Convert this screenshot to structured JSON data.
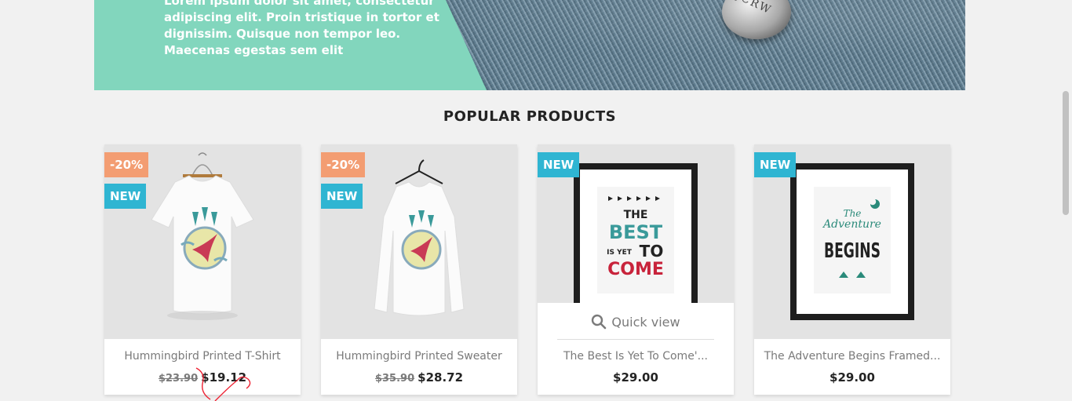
{
  "banner": {
    "text": "Lorem ipsum dolor sit amet, consectetur adipiscing elit. Proin tristique in tortor et dignissim. Quisque non tempor leo. Maecenas egestas sem elit",
    "stud_text": "JCRW",
    "colors": {
      "panel": "#82d6bd"
    }
  },
  "section": {
    "title": "POPULAR PRODUCTS"
  },
  "products": [
    {
      "name": "Hummingbird Printed T-Shirt",
      "old_price": "$23.90",
      "price": "$19.12",
      "discount": "-20%",
      "new_label": "NEW"
    },
    {
      "name": "Hummingbird Printed Sweater",
      "old_price": "$35.90",
      "price": "$28.72",
      "discount": "-20%",
      "new_label": "NEW"
    },
    {
      "name": "The Best Is Yet To Come'...",
      "price": "$29.00",
      "new_label": "NEW",
      "quick_view": "Quick view",
      "poster": {
        "line1": "THE",
        "line2": "BEST",
        "line3": "IS YET",
        "line4": "TO",
        "line5": "COME"
      }
    },
    {
      "name": "The Adventure Begins Framed...",
      "price": "$29.00",
      "new_label": "NEW",
      "poster": {
        "line1": "The",
        "line2": "Adventure",
        "line3": "BEGINS"
      }
    }
  ],
  "colors": {
    "discount": "#f39d72",
    "new": "#2fb5d2",
    "text": "#232323",
    "muted": "#7a7a7a"
  }
}
